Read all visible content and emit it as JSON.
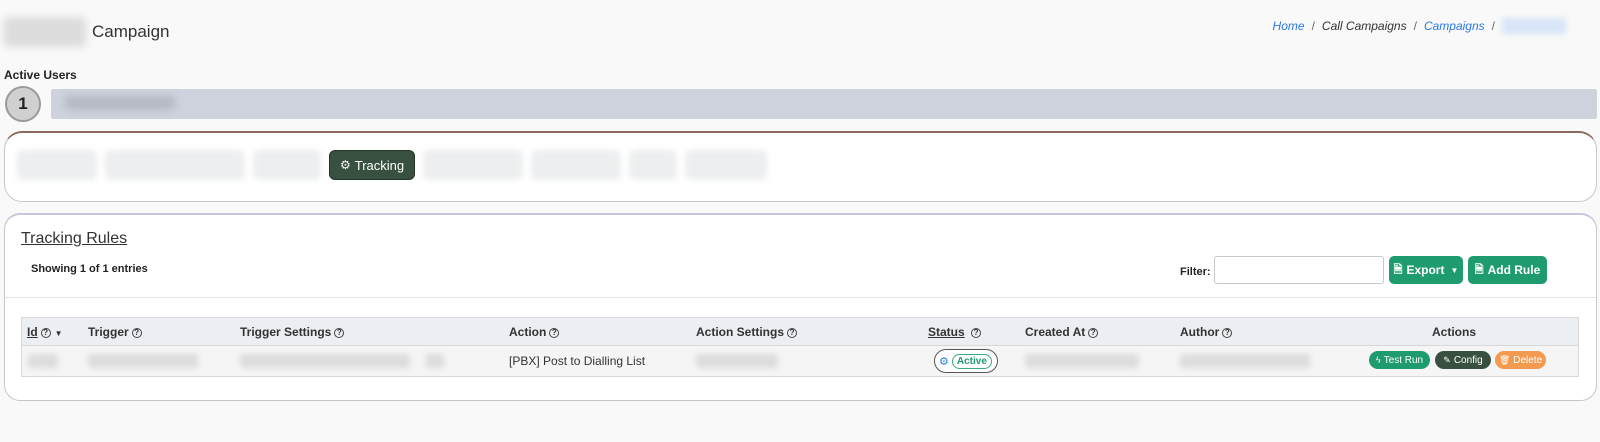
{
  "header": {
    "title": "Campaign"
  },
  "breadcrumbs": [
    {
      "label": "Home",
      "link": true
    },
    {
      "label": "Call Campaigns",
      "link": false
    },
    {
      "label": "Campaigns",
      "link": true
    }
  ],
  "active_users": {
    "label": "Active Users",
    "count": "1"
  },
  "tabs": {
    "active_label": "Tracking"
  },
  "rules": {
    "title": "Tracking Rules",
    "showing": "Showing 1 of 1 entries",
    "filter_label": "Filter:",
    "filter_value": "",
    "export_label": "Export",
    "add_rule_label": "Add Rule"
  },
  "table": {
    "columns": [
      "Id",
      "Trigger",
      "Trigger Settings",
      "Action",
      "Action Settings",
      "Status",
      "Created At",
      "Author",
      "Actions"
    ],
    "row": {
      "action": "[PBX] Post to Dialling List",
      "status": "Active",
      "btn_test": "Test Run",
      "btn_config": "Config",
      "btn_delete": "Delete"
    }
  },
  "colors": {
    "accent_green": "#1f9c6d",
    "dark_green": "#38503f",
    "delete_orange": "#f29a4f",
    "link_blue": "#2a7ae2"
  }
}
